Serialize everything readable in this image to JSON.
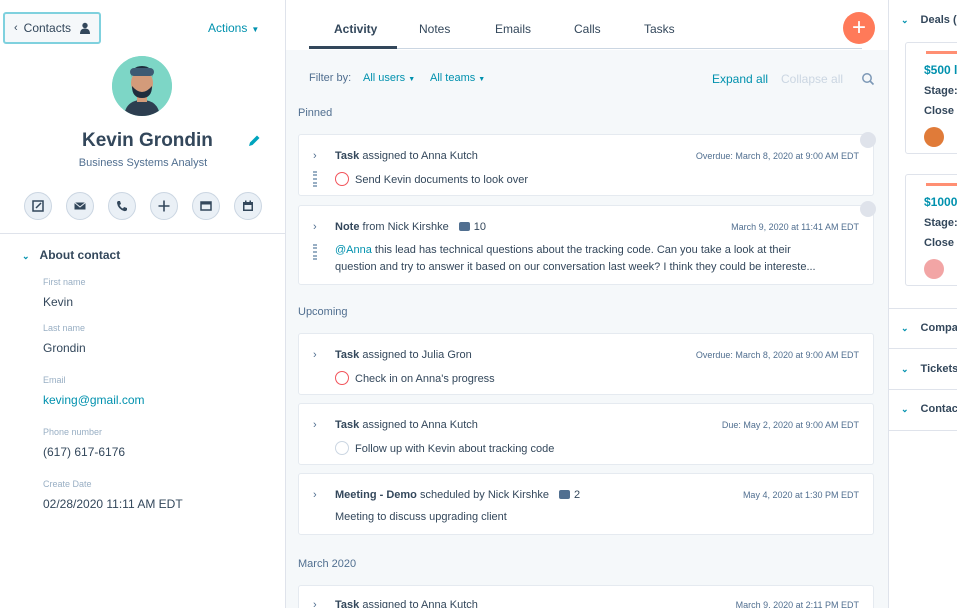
{
  "left": {
    "back_label": "Contacts",
    "actions_label": "Actions",
    "name": "Kevin Grondin",
    "job_title": "Business Systems Analyst",
    "about_title": "About contact",
    "properties": [
      {
        "label": "First name",
        "value": "Kevin"
      },
      {
        "label": "Last name",
        "value": "Grondin"
      },
      {
        "label": "Email",
        "value": "keving@gmail.com"
      },
      {
        "label": "Phone number",
        "value": "(617) 617-6176"
      },
      {
        "label": "Create Date",
        "value": "02/28/2020 11:11 AM EDT"
      }
    ]
  },
  "center": {
    "tabs": [
      "Activity",
      "Notes",
      "Emails",
      "Calls",
      "Tasks"
    ],
    "fab_label": "+",
    "filter_label": "Filter by:",
    "filter_users": "All users",
    "filter_teams": "All teams",
    "expand_all": "Expand all",
    "collapse_all": "Collapse all",
    "sections": {
      "pinned": "Pinned",
      "upcoming": "Upcoming",
      "march": "March 2020"
    },
    "cards": [
      {
        "type": "Task",
        "head": " assigned to Anna Kutch",
        "date": "Overdue: March 8, 2020 at 9:00 AM EDT",
        "body": "Send Kevin documents to look over"
      },
      {
        "type": "Note",
        "head": " from Nick Kirshke",
        "comments": "10",
        "date": "March 9, 2020 at 11:41 AM EDT",
        "mention": "@Anna",
        "body1": " this lead has technical questions about the tracking code. Can you take a look at their",
        "body2": "question and try to answer it based on our conversation last week? I think they could be intereste..."
      },
      {
        "type": "Task",
        "head": " assigned to Julia Gron",
        "date": "Overdue: March 8, 2020 at 9:00 AM EDT",
        "body": "Check in on Anna's progress"
      },
      {
        "type": "Task",
        "head": " assigned to Anna Kutch",
        "date": "Due: May 2, 2020 at 9:00 AM EDT",
        "body": "Follow up with Kevin about tracking code"
      },
      {
        "type": "Meeting - Demo",
        "head": " scheduled by Nick Kirshke",
        "comments": "2",
        "date": "May 4, 2020 at 1:30 PM EDT",
        "body": "Meeting to discuss upgrading client"
      },
      {
        "type": "Task",
        "head": " assigned to Anna Kutch",
        "date": "March 9, 2020 at 2:11 PM EDT"
      }
    ]
  },
  "right": {
    "deals_label": "Deals (",
    "deals": [
      {
        "amount": "$500 l",
        "stage": "Stage:",
        "close": "Close"
      },
      {
        "amount": "$1000",
        "stage": "Stage:",
        "close": "Close"
      }
    ],
    "companies_label": "Compa",
    "tickets_label": "Tickets",
    "contacts_label": "Contac"
  },
  "colors": {
    "accent": "#0091ae",
    "fab": "#ff7a59",
    "overdue": "#f2545b"
  }
}
